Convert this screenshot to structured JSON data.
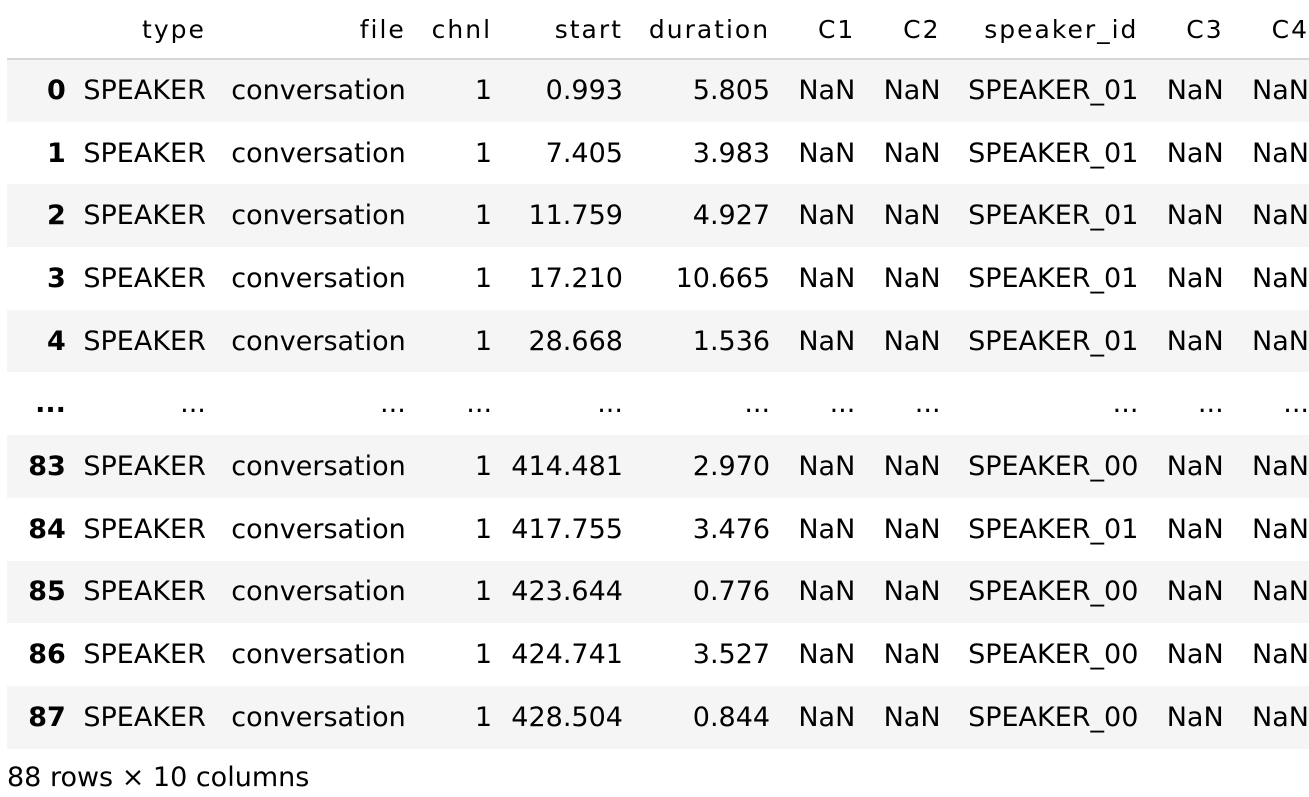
{
  "table": {
    "columns": [
      "",
      "type",
      "file",
      "chnl",
      "start",
      "duration",
      "C1",
      "C2",
      "speaker_id",
      "C3",
      "C4"
    ],
    "rows": [
      [
        "0",
        "SPEAKER",
        "conversation",
        "1",
        "0.993",
        "5.805",
        "NaN",
        "NaN",
        "SPEAKER_01",
        "NaN",
        "NaN"
      ],
      [
        "1",
        "SPEAKER",
        "conversation",
        "1",
        "7.405",
        "3.983",
        "NaN",
        "NaN",
        "SPEAKER_01",
        "NaN",
        "NaN"
      ],
      [
        "2",
        "SPEAKER",
        "conversation",
        "1",
        "11.759",
        "4.927",
        "NaN",
        "NaN",
        "SPEAKER_01",
        "NaN",
        "NaN"
      ],
      [
        "3",
        "SPEAKER",
        "conversation",
        "1",
        "17.210",
        "10.665",
        "NaN",
        "NaN",
        "SPEAKER_01",
        "NaN",
        "NaN"
      ],
      [
        "4",
        "SPEAKER",
        "conversation",
        "1",
        "28.668",
        "1.536",
        "NaN",
        "NaN",
        "SPEAKER_01",
        "NaN",
        "NaN"
      ],
      [
        "...",
        "...",
        "...",
        "...",
        "...",
        "...",
        "...",
        "...",
        "...",
        "...",
        "..."
      ],
      [
        "83",
        "SPEAKER",
        "conversation",
        "1",
        "414.481",
        "2.970",
        "NaN",
        "NaN",
        "SPEAKER_00",
        "NaN",
        "NaN"
      ],
      [
        "84",
        "SPEAKER",
        "conversation",
        "1",
        "417.755",
        "3.476",
        "NaN",
        "NaN",
        "SPEAKER_01",
        "NaN",
        "NaN"
      ],
      [
        "85",
        "SPEAKER",
        "conversation",
        "1",
        "423.644",
        "0.776",
        "NaN",
        "NaN",
        "SPEAKER_00",
        "NaN",
        "NaN"
      ],
      [
        "86",
        "SPEAKER",
        "conversation",
        "1",
        "424.741",
        "3.527",
        "NaN",
        "NaN",
        "SPEAKER_00",
        "NaN",
        "NaN"
      ],
      [
        "87",
        "SPEAKER",
        "conversation",
        "1",
        "428.504",
        "0.844",
        "NaN",
        "NaN",
        "SPEAKER_00",
        "NaN",
        "NaN"
      ]
    ]
  },
  "footer": {
    "shape_text": "88 rows × 10 columns"
  }
}
